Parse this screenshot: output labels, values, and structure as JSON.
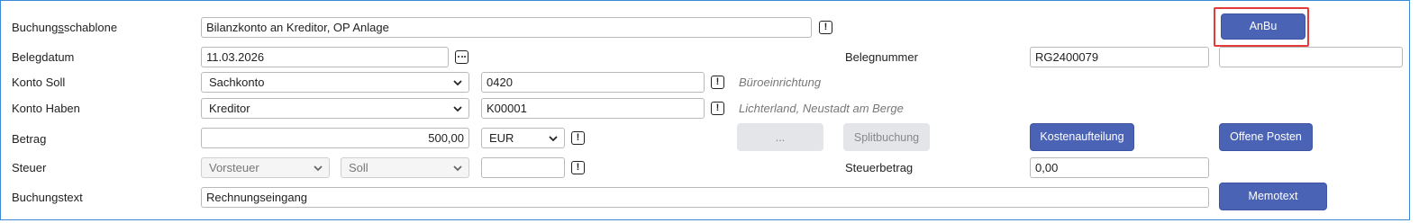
{
  "labels": {
    "buchungsschablone_pre": "Buchung",
    "buchungsschablone_ul": "s",
    "buchungsschablone_post": "schablone",
    "belegdatum": "Belegdatum",
    "konto_soll": "Konto Soll",
    "konto_haben": "Konto Haben",
    "betrag": "Betrag",
    "steuer": "Steuer",
    "buchungstext": "Buchungstext",
    "belegnummer": "Belegnummer",
    "steuerbetrag": "Steuerbetrag"
  },
  "fields": {
    "buchungsschablone": "Bilanzkonto an Kreditor, OP Anlage",
    "belegdatum": "11.03.2026",
    "belegnummer": "RG2400079",
    "belegnummer2": "",
    "konto_soll_type": "Sachkonto",
    "konto_soll_number": "0420",
    "konto_soll_hint": "Büroeinrichtung",
    "konto_haben_type": "Kreditor",
    "konto_haben_number": "K00001",
    "konto_haben_hint": "Lichterland, Neustadt am Berge",
    "betrag": "500,00",
    "waehrung": "EUR",
    "steuer_art": "Vorsteuer",
    "steuer_seite": "Soll",
    "steuer_code": "",
    "steuerbetrag": "0,00",
    "buchungstext": "Rechnungseingang"
  },
  "buttons": {
    "anbu": "AnBu",
    "ellipsis": "...",
    "splitbuchung": "Splitbuchung",
    "kostenaufteilung": "Kostenaufteilung",
    "offene_posten": "Offene Posten",
    "memotext": "Memotext"
  },
  "colors": {
    "primary_button": "#4a63b5",
    "highlight": "#e23b3b",
    "frame": "#3a8ad6"
  }
}
